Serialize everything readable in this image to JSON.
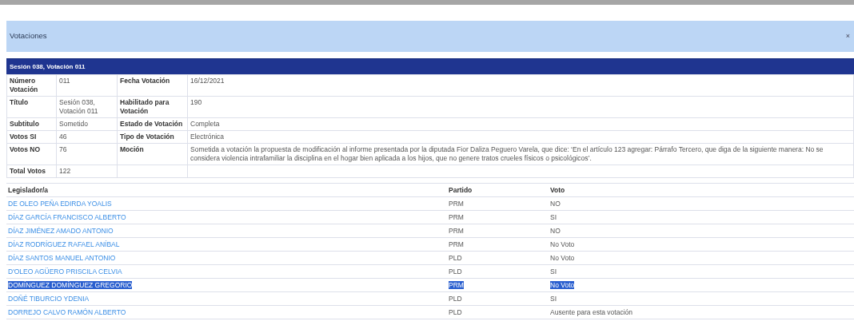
{
  "panel": {
    "title": "Votaciones",
    "close": "×"
  },
  "section": {
    "title": "Sesión 038, Votación 011"
  },
  "details": [
    {
      "label": "Número Votación",
      "value": "011",
      "label_2": "Fecha Votación",
      "value_2": "16/12/2021"
    },
    {
      "label": "Título",
      "value": "Sesión 038, Votación 011",
      "label_2": "Habilitado para Votación",
      "value_2": "190"
    },
    {
      "label": "Subtitulo",
      "value": "Sometido",
      "label_2": "Estado de Votación",
      "value_2": "Completa"
    },
    {
      "label": "Votos SI",
      "value": "46",
      "label_2": "Tipo de Votación",
      "value_2": "Electrónica"
    },
    {
      "label": "Votos NO",
      "value": "76",
      "label_2": "Moción",
      "value_2": "Sometida a votación la propuesta de modificación al informe presentada por la diputada Fior Daliza Peguero Varela, que dice: ‘En el artículo 123 agregar: Párrafo Tercero, que diga de la siguiente manera: No se considera violencia intrafamiliar la disciplina en el hogar bien aplicada a los hijos, que no genere tratos crueles físicos o psicológicos’."
    },
    {
      "label": "Total Votos",
      "value": "122"
    }
  ],
  "votes": {
    "columns": [
      "Legislador/a",
      "Partido",
      "Voto"
    ],
    "rows": [
      {
        "name": "DE OLEO PEÑA EDIRDA YOALIS",
        "party": "PRM",
        "vote": "NO",
        "selected": false
      },
      {
        "name": "DÍAZ GARCÍA FRANCISCO ALBERTO",
        "party": "PRM",
        "vote": "SI",
        "selected": false
      },
      {
        "name": "DÍAZ JIMÉNEZ AMADO ANTONIO",
        "party": "PRM",
        "vote": "NO",
        "selected": false
      },
      {
        "name": "DÍAZ RODRÍGUEZ RAFAEL ANÍBAL",
        "party": "PRM",
        "vote": "No Voto",
        "selected": false
      },
      {
        "name": "DÍAZ SANTOS MANUEL ANTONIO",
        "party": "PLD",
        "vote": "No Voto",
        "selected": false
      },
      {
        "name": "D'OLEO AGÜERO PRISCILA CELVIA",
        "party": "PLD",
        "vote": "SI",
        "selected": false
      },
      {
        "name": "DOMÍNGUEZ DOMÍNGUEZ GREGORIO",
        "party": "PRM",
        "vote": "No Voto",
        "selected": true
      },
      {
        "name": "DOÑÉ TIBURCIO YDENIA",
        "party": "PLD",
        "vote": "SI",
        "selected": false
      },
      {
        "name": "DORREJO CALVO RAMÓN ALBERTO",
        "party": "PLD",
        "vote": "Ausente para esta votación",
        "selected": false
      }
    ]
  }
}
